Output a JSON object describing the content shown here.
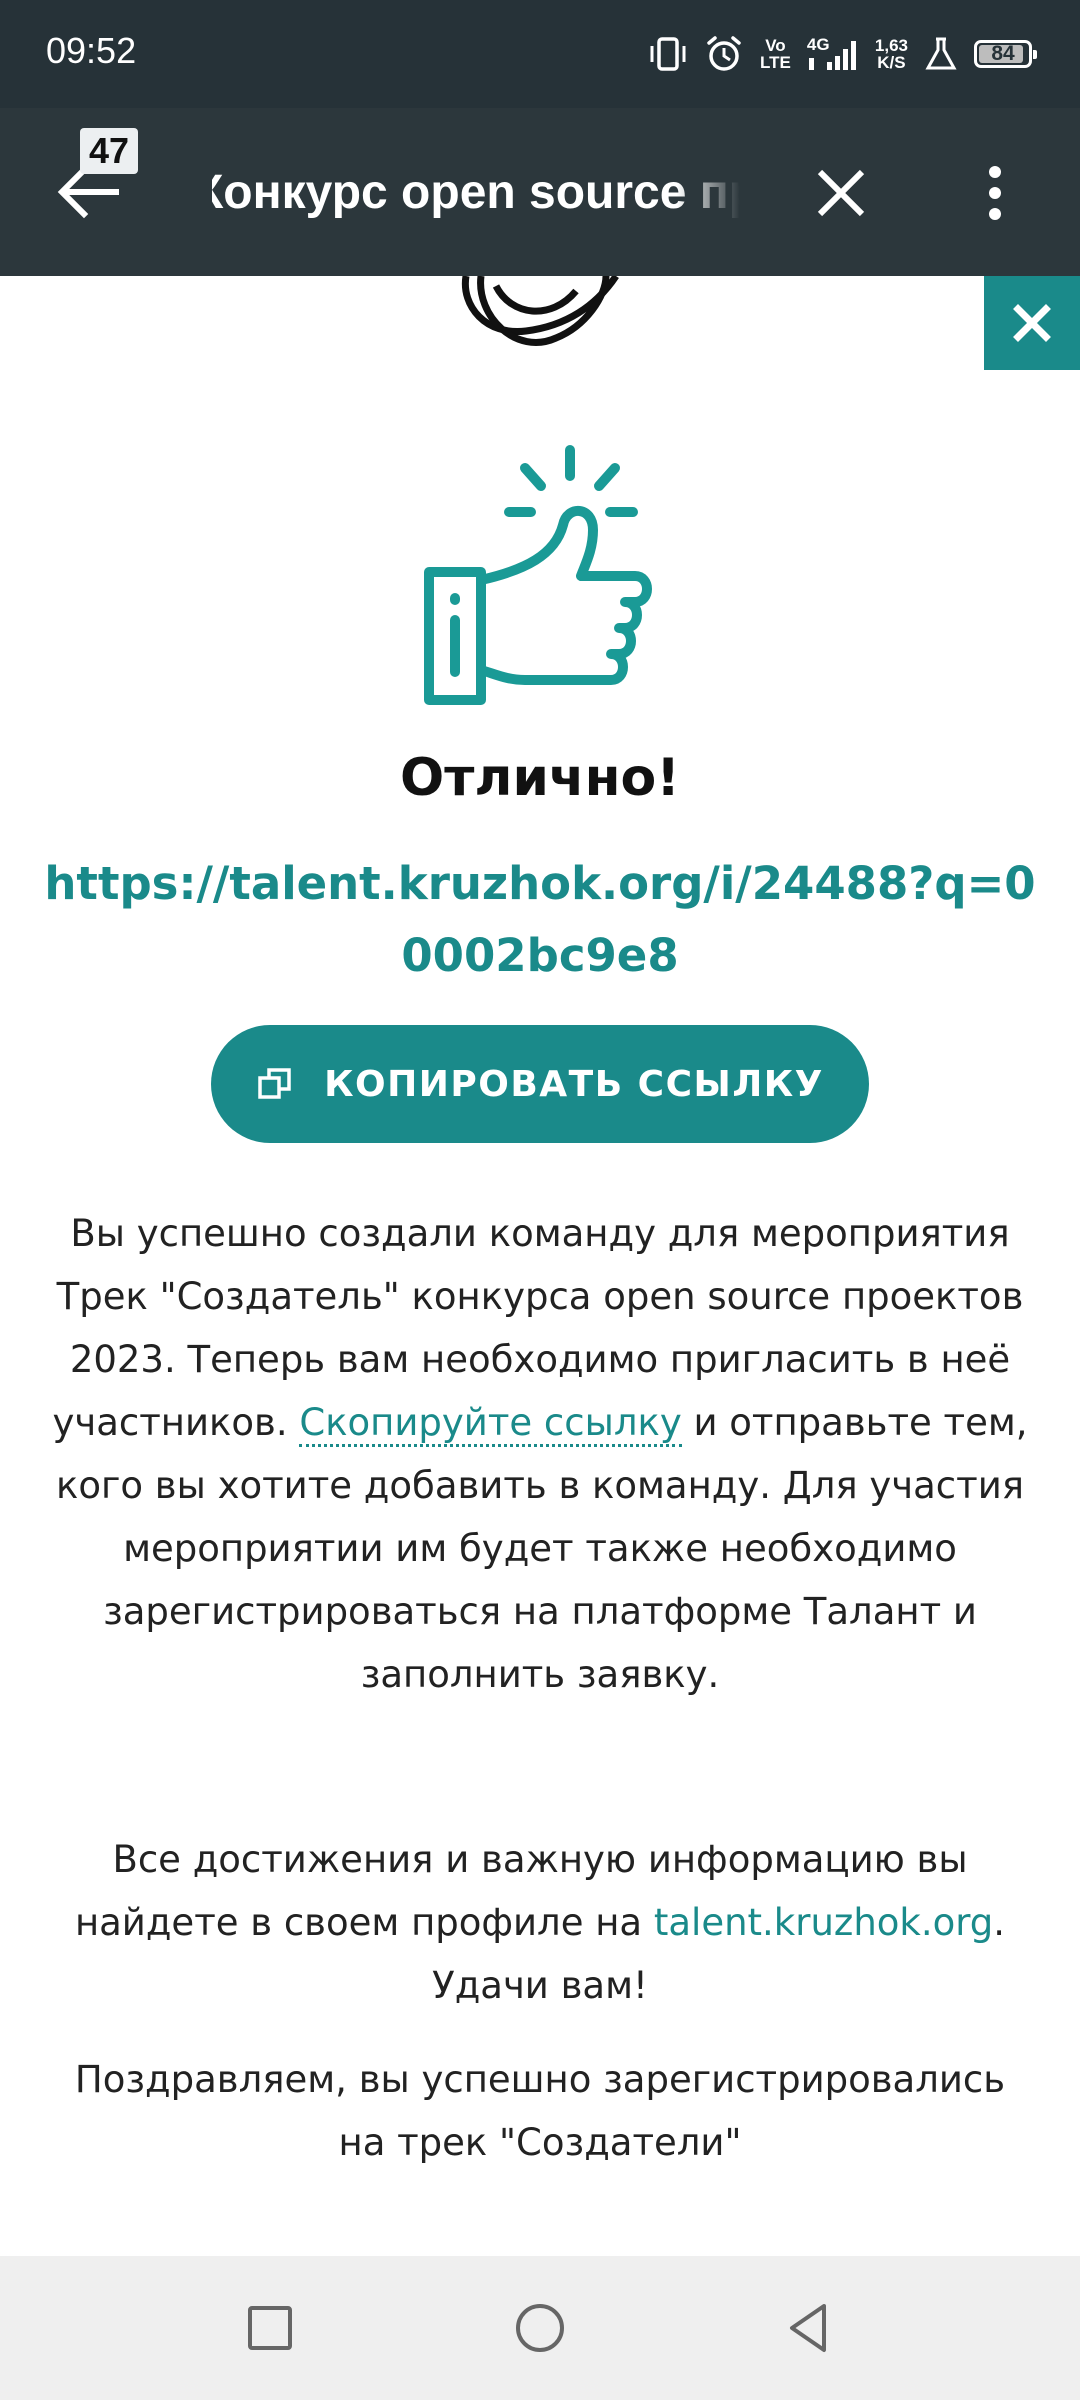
{
  "status_bar": {
    "time": "09:52",
    "net_top": "Vo",
    "net_bottom": "LTE",
    "signal_label": "4G",
    "speed_top": "1,63",
    "speed_bottom": "K/S",
    "battery": "84",
    "icons": [
      "vibrate-icon",
      "alarm-icon",
      "volte-icon",
      "signal-icon",
      "speed-indicator",
      "flask-icon",
      "battery-icon"
    ]
  },
  "toolbar": {
    "tab_count": "47",
    "title": "Конкурс open source проектов",
    "icons": [
      "back-arrow-icon",
      "close-icon",
      "more-vert-icon"
    ]
  },
  "content": {
    "heading": "Отлично!",
    "invite_link": "https://talent.kruzhok.org/i/24488?q=00002bc9e8",
    "copy_button": "КОПИРОВАТЬ ССЫЛКУ",
    "p1_text1": "Вы успешно создали команду для мероприятия Трек \"Создатель\" конкурса open source проектов 2023. Теперь вам необходимо пригласить в неё участников.",
    "p1_link": "Скопируйте ссылку",
    "p1_text2": " и отправьте тем, кого вы хотите добавить в команду. Для участия мероприятии им будет также необходимо зарегистрироваться на платформе Талант и заполнить заявку.",
    "p2_text1": "Все достижения и важную информацию вы найдете в своем профиле на ",
    "p2_link": "talent.kruzhok.org",
    "p2_text2": ". Удачи вам!",
    "p3_text": "Поздравляем, вы успешно зарегистрировались на трек \"Создатели\"",
    "accent_color": "#1a8a8a"
  },
  "navbar": {
    "icons": [
      "recent-apps-icon",
      "home-icon",
      "back-icon"
    ]
  }
}
